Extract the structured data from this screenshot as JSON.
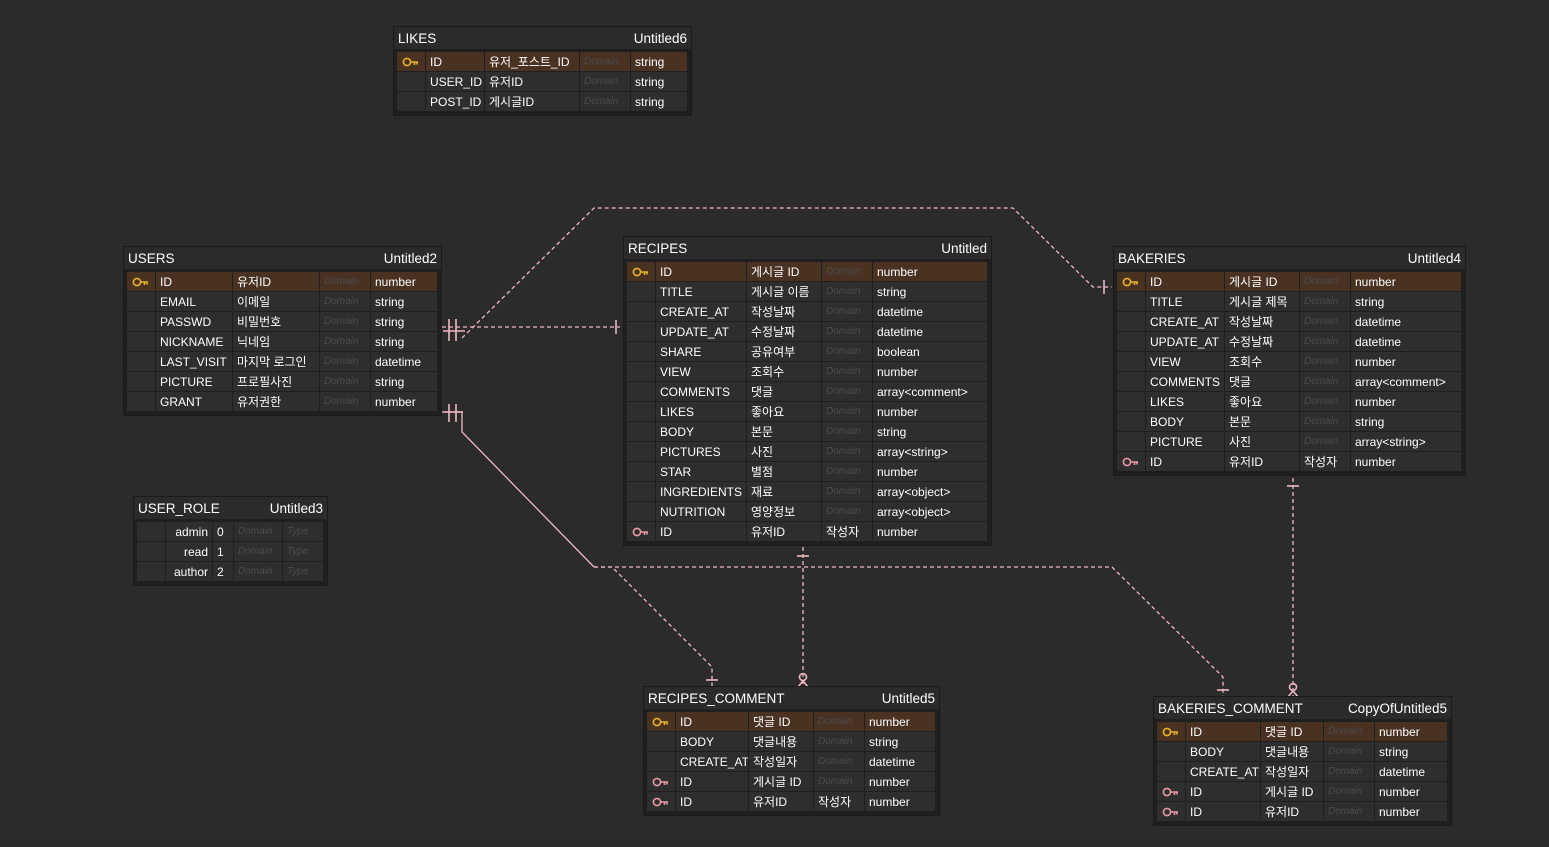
{
  "colors": {
    "background": "#2b2b2b",
    "table_body": "#1f1f1f",
    "cell": "#2e2e2e",
    "pk_row": "#4a3222",
    "pk_key_icon": "#e8b424",
    "fk_key_icon": "#e89aa4",
    "relation_line": "#f0b8c0",
    "placeholder_text": "#4c4c4c"
  },
  "entities": [
    {
      "id": "likes",
      "name": "LIKES",
      "subtitle": "Untitled6",
      "rows": [
        {
          "key": "pk-key-icon",
          "name": "ID",
          "logical": "유저_포스트_ID",
          "domain": "Domain",
          "type": "string"
        },
        {
          "key": "",
          "name": "USER_ID",
          "logical": "유저ID",
          "domain": "Domain",
          "type": "string"
        },
        {
          "key": "",
          "name": "POST_ID",
          "logical": "게시글ID",
          "domain": "Domain",
          "type": "string"
        }
      ]
    },
    {
      "id": "users",
      "name": "USERS",
      "subtitle": "Untitled2",
      "rows": [
        {
          "key": "pk-key-icon",
          "name": "ID",
          "logical": "유저ID",
          "domain": "Domain",
          "type": "number"
        },
        {
          "key": "",
          "name": "EMAIL",
          "logical": "이메일",
          "domain": "Domain",
          "type": "string"
        },
        {
          "key": "",
          "name": "PASSWD",
          "logical": "비밀번호",
          "domain": "Domain",
          "type": "string"
        },
        {
          "key": "",
          "name": "NICKNAME",
          "logical": "닉네임",
          "domain": "Domain",
          "type": "string"
        },
        {
          "key": "",
          "name": "LAST_VISIT",
          "logical": "마지막 로그인",
          "domain": "Domain",
          "type": "datetime"
        },
        {
          "key": "",
          "name": "PICTURE",
          "logical": "프로필사진",
          "domain": "Domain",
          "type": "string"
        },
        {
          "key": "",
          "name": "GRANT",
          "logical": "유저권한",
          "domain": "Domain",
          "type": "number"
        }
      ]
    },
    {
      "id": "recipes",
      "name": "RECIPES",
      "subtitle": "Untitled",
      "rows": [
        {
          "key": "pk-key-icon",
          "name": "ID",
          "logical": "게시글 ID",
          "domain": "Domain",
          "type": "number"
        },
        {
          "key": "",
          "name": "TITLE",
          "logical": "게시글 이름",
          "domain": "Domain",
          "type": "string"
        },
        {
          "key": "",
          "name": "CREATE_AT",
          "logical": "작성날짜",
          "domain": "Domain",
          "type": "datetime"
        },
        {
          "key": "",
          "name": "UPDATE_AT",
          "logical": "수정날짜",
          "domain": "Domain",
          "type": "datetime"
        },
        {
          "key": "",
          "name": "SHARE",
          "logical": "공유여부",
          "domain": "Domain",
          "type": "boolean"
        },
        {
          "key": "",
          "name": "VIEW",
          "logical": "조회수",
          "domain": "Domain",
          "type": "number"
        },
        {
          "key": "",
          "name": "COMMENTS",
          "logical": "댓글",
          "domain": "Domain",
          "type": "array<comment>"
        },
        {
          "key": "",
          "name": "LIKES",
          "logical": "좋아요",
          "domain": "Domain",
          "type": "number"
        },
        {
          "key": "",
          "name": "BODY",
          "logical": "본문",
          "domain": "Domain",
          "type": "string"
        },
        {
          "key": "",
          "name": "PICTURES",
          "logical": "사진",
          "domain": "Domain",
          "type": "array<string>"
        },
        {
          "key": "",
          "name": "STAR",
          "logical": "별점",
          "domain": "Domain",
          "type": "number"
        },
        {
          "key": "",
          "name": "INGREDIENTS",
          "logical": "재료",
          "domain": "Domain",
          "type": "array<object>"
        },
        {
          "key": "",
          "name": "NUTRITION",
          "logical": "영양정보",
          "domain": "Domain",
          "type": "array<object>"
        },
        {
          "key": "fk-key-icon",
          "name": "ID",
          "logical": "유저ID",
          "domain": "작성자",
          "type": "number"
        }
      ]
    },
    {
      "id": "bakeries",
      "name": "BAKERIES",
      "subtitle": "Untitled4",
      "rows": [
        {
          "key": "pk-key-icon",
          "name": "ID",
          "logical": "게시글 ID",
          "domain": "Domain",
          "type": "number"
        },
        {
          "key": "",
          "name": "TITLE",
          "logical": "게시글 제목",
          "domain": "Domain",
          "type": "string"
        },
        {
          "key": "",
          "name": "CREATE_AT",
          "logical": "작성날짜",
          "domain": "Domain",
          "type": "datetime"
        },
        {
          "key": "",
          "name": "UPDATE_AT",
          "logical": "수정날짜",
          "domain": "Domain",
          "type": "datetime"
        },
        {
          "key": "",
          "name": "VIEW",
          "logical": "조회수",
          "domain": "Domain",
          "type": "number"
        },
        {
          "key": "",
          "name": "COMMENTS",
          "logical": "댓글",
          "domain": "Domain",
          "type": "array<comment>"
        },
        {
          "key": "",
          "name": "LIKES",
          "logical": "좋아요",
          "domain": "Domain",
          "type": "number"
        },
        {
          "key": "",
          "name": "BODY",
          "logical": "본문",
          "domain": "Domain",
          "type": "string"
        },
        {
          "key": "",
          "name": "PICTURE",
          "logical": "사진",
          "domain": "Domain",
          "type": "array<string>"
        },
        {
          "key": "fk-key-icon",
          "name": "ID",
          "logical": "유저ID",
          "domain": "작성자",
          "type": "number"
        }
      ]
    },
    {
      "id": "user_role",
      "name": "USER_ROLE",
      "subtitle": "Untitled3",
      "rows": [
        {
          "key": "",
          "name": "admin",
          "logical": "0",
          "domain": "Domain",
          "type": "Type"
        },
        {
          "key": "",
          "name": "read",
          "logical": "1",
          "domain": "Domain",
          "type": "Type"
        },
        {
          "key": "",
          "name": "author",
          "logical": "2",
          "domain": "Domain",
          "type": "Type"
        }
      ]
    },
    {
      "id": "recipes_comment",
      "name": "RECIPES_COMMENT",
      "subtitle": "Untitled5",
      "rows": [
        {
          "key": "pk-key-icon",
          "name": "ID",
          "logical": "댓글 ID",
          "domain": "Domain",
          "type": "number"
        },
        {
          "key": "",
          "name": "BODY",
          "logical": "댓글내용",
          "domain": "Domain",
          "type": "string"
        },
        {
          "key": "",
          "name": "CREATE_AT",
          "logical": "작성일자",
          "domain": "Domain",
          "type": "datetime"
        },
        {
          "key": "fk-key-icon",
          "name": "ID",
          "logical": "게시글 ID",
          "domain": "Domain",
          "type": "number"
        },
        {
          "key": "fk-key-icon",
          "name": "ID",
          "logical": "유저ID",
          "domain": "작성자",
          "type": "number"
        }
      ]
    },
    {
      "id": "bakeries_comment",
      "name": "BAKERIES_COMMENT",
      "subtitle": "CopyOfUntitled5",
      "rows": [
        {
          "key": "pk-key-icon",
          "name": "ID",
          "logical": "댓글 ID",
          "domain": "Domain",
          "type": "number"
        },
        {
          "key": "",
          "name": "BODY",
          "logical": "댓글내용",
          "domain": "Domain",
          "type": "string"
        },
        {
          "key": "",
          "name": "CREATE_AT",
          "logical": "작성일자",
          "domain": "Domain",
          "type": "datetime"
        },
        {
          "key": "fk-key-icon",
          "name": "ID",
          "logical": "게시글 ID",
          "domain": "Domain",
          "type": "number"
        },
        {
          "key": "fk-key-icon",
          "name": "ID",
          "logical": "유저ID",
          "domain": "Domain",
          "type": "number"
        }
      ]
    }
  ]
}
